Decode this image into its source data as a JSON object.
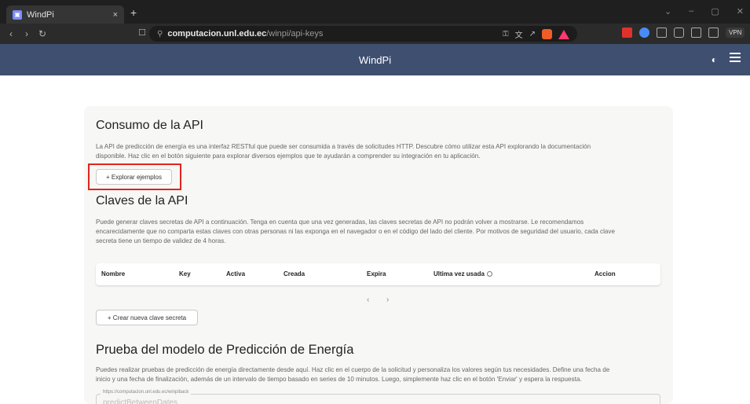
{
  "browser": {
    "tab_title": "WindPi",
    "tab_close": "×",
    "new_tab": "+",
    "url_host": "computacion.unl.edu.ec",
    "url_path": "/winpi/api-keys",
    "vpn_label": "VPN"
  },
  "header": {
    "title": "WindPi"
  },
  "consumo": {
    "title": "Consumo de la API",
    "line1": "La API de predicción de energía es una interfaz RESTful que puede ser consumida a través de solicitudes HTTP. Descubre cómo utilizar esta API explorando la documentación",
    "line2": "disponible. Haz clic en el botón siguiente para explorar diversos ejemplos que te ayudarán a comprender su integración en tu aplicación.",
    "button": "+ Explorar ejemplos"
  },
  "claves": {
    "title": "Claves de la API",
    "line1": "Puede generar claves secretas de API a continuación. Tenga en cuenta que una vez generadas, las claves secretas de API no podrán volver a mostrarse. Le recomendamos",
    "line2": "encarecidamente que no comparta estas claves con otras personas ni las exponga en el navegador o en el código del lado del cliente. Por motivos de seguridad del usuario, cada clave",
    "line3": "secreta tiene un tiempo de validez de 4 horas.",
    "columns": [
      "Nombre",
      "Key",
      "Activa",
      "Creada",
      "Expira",
      "Ultima vez usada",
      "Accion"
    ],
    "pager_prev": "‹",
    "pager_next": "›",
    "create_button": "+ Crear nueva clave secreta"
  },
  "prueba": {
    "title": "Prueba del modelo de Predicción de Energía",
    "line1": "Puedes realizar pruebas de predicción de energía directamente desde aquí. Haz clic en el cuerpo de la solicitud y personaliza los valores según tus necesidades. Define una fecha de",
    "line2": "inicio y una fecha de finalización, además de un intervalo de tiempo basado en series de 10 minutos. Luego, simplemente haz clic en el botón 'Enviar' y espera la respuesta.",
    "endpoint_label": "https://computacion.unl.edu.ec/winpiback",
    "endpoint_value": "predictBetweenDates"
  },
  "colors": {
    "header_bg": "#3f4f70",
    "highlight": "#e0251f",
    "card_bg": "#f7f7f5"
  }
}
